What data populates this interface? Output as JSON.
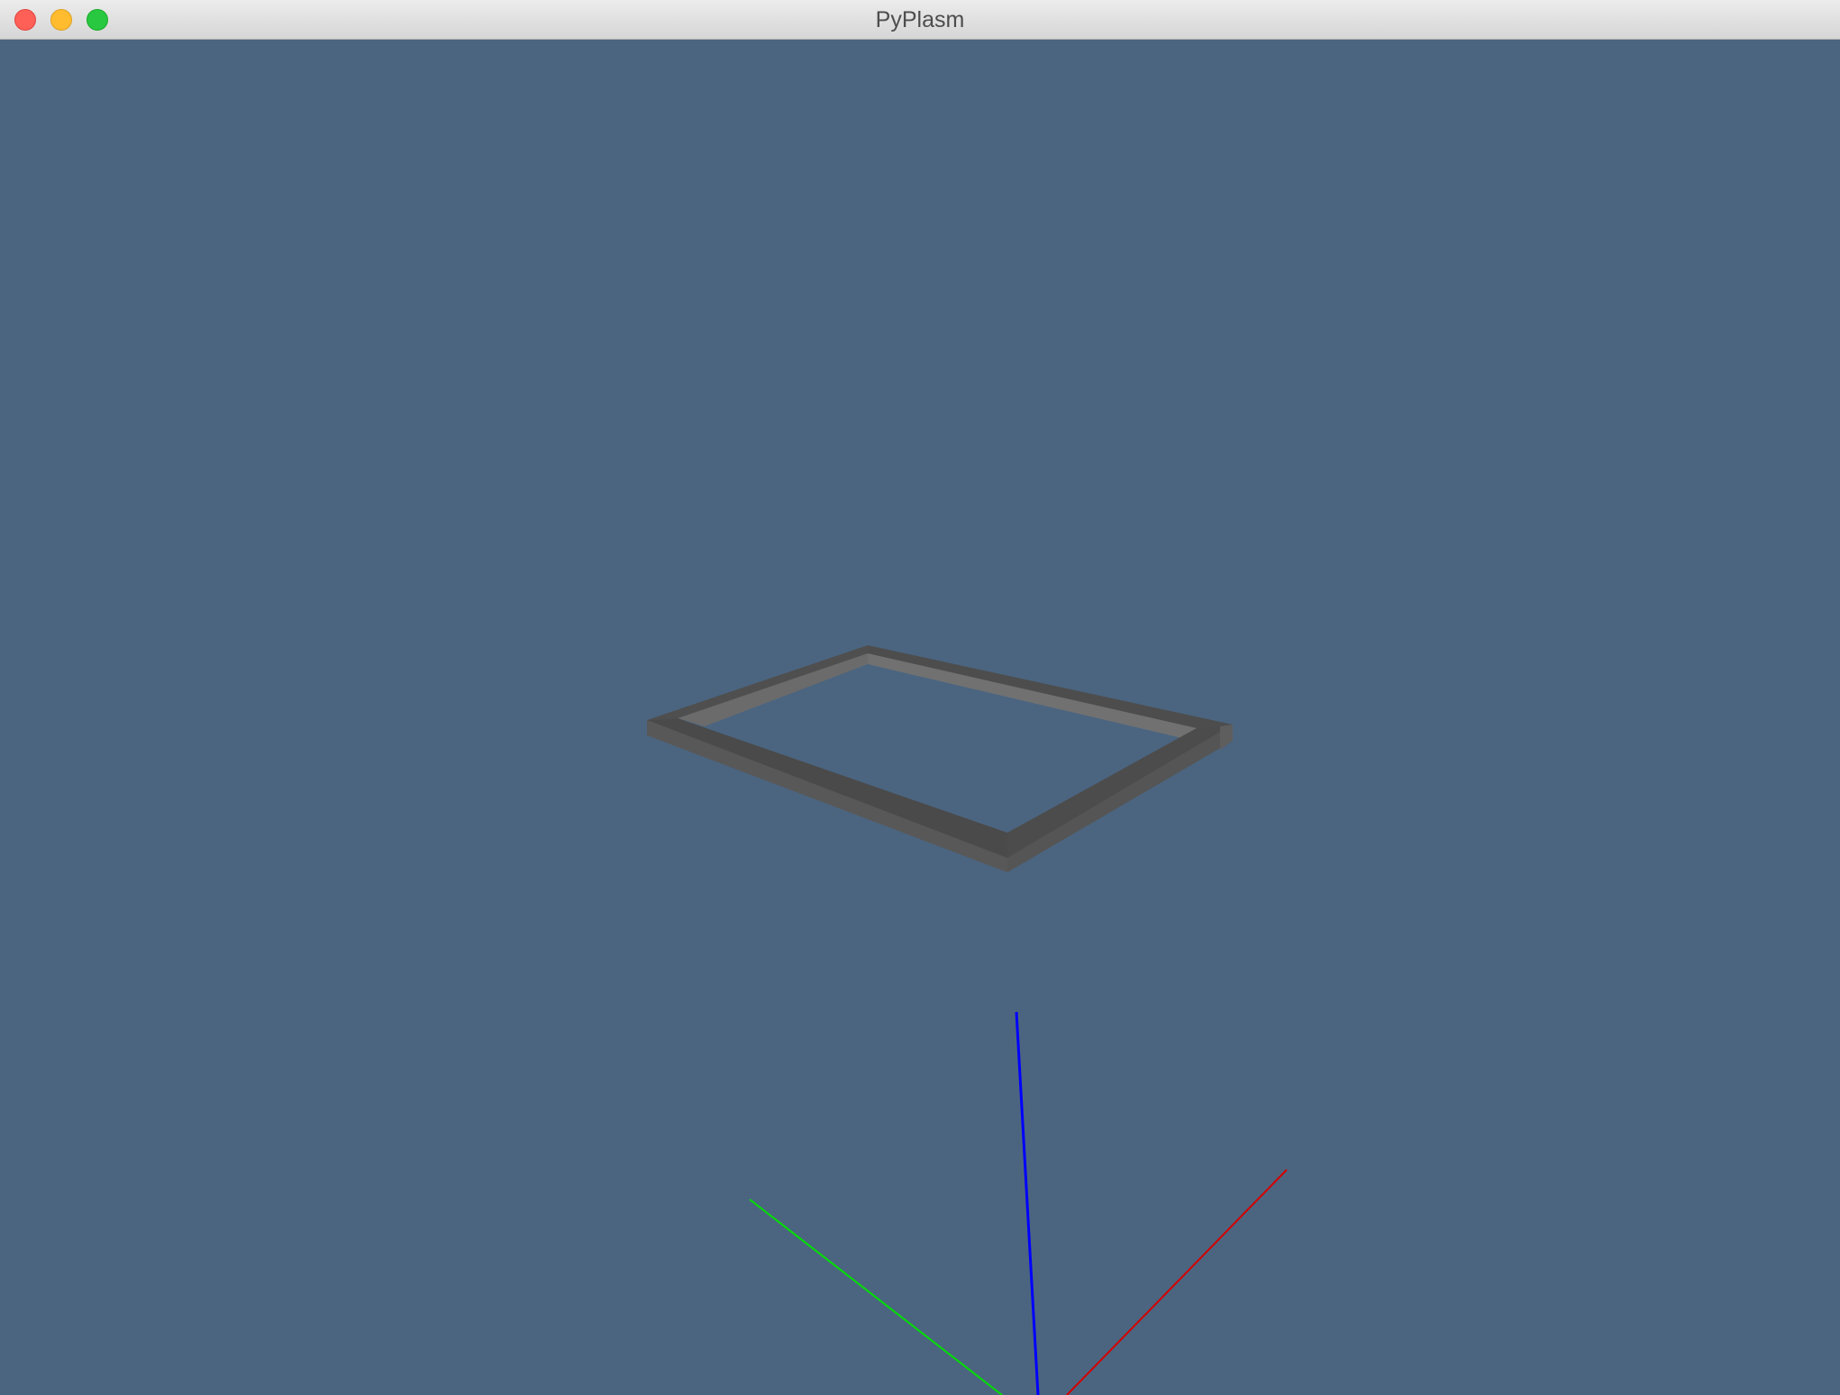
{
  "window": {
    "title": "PyPlasm"
  },
  "viewport": {
    "background": "#4b6580",
    "model": {
      "kind": "rectangular-frame",
      "top_color": "#4f4f4f",
      "inner_wall_color": "#6e6e6e",
      "outer_side_color": "#585858"
    },
    "axes": {
      "x_color": "#e00000",
      "y_color": "#00e000",
      "z_color": "#0000ff"
    }
  }
}
